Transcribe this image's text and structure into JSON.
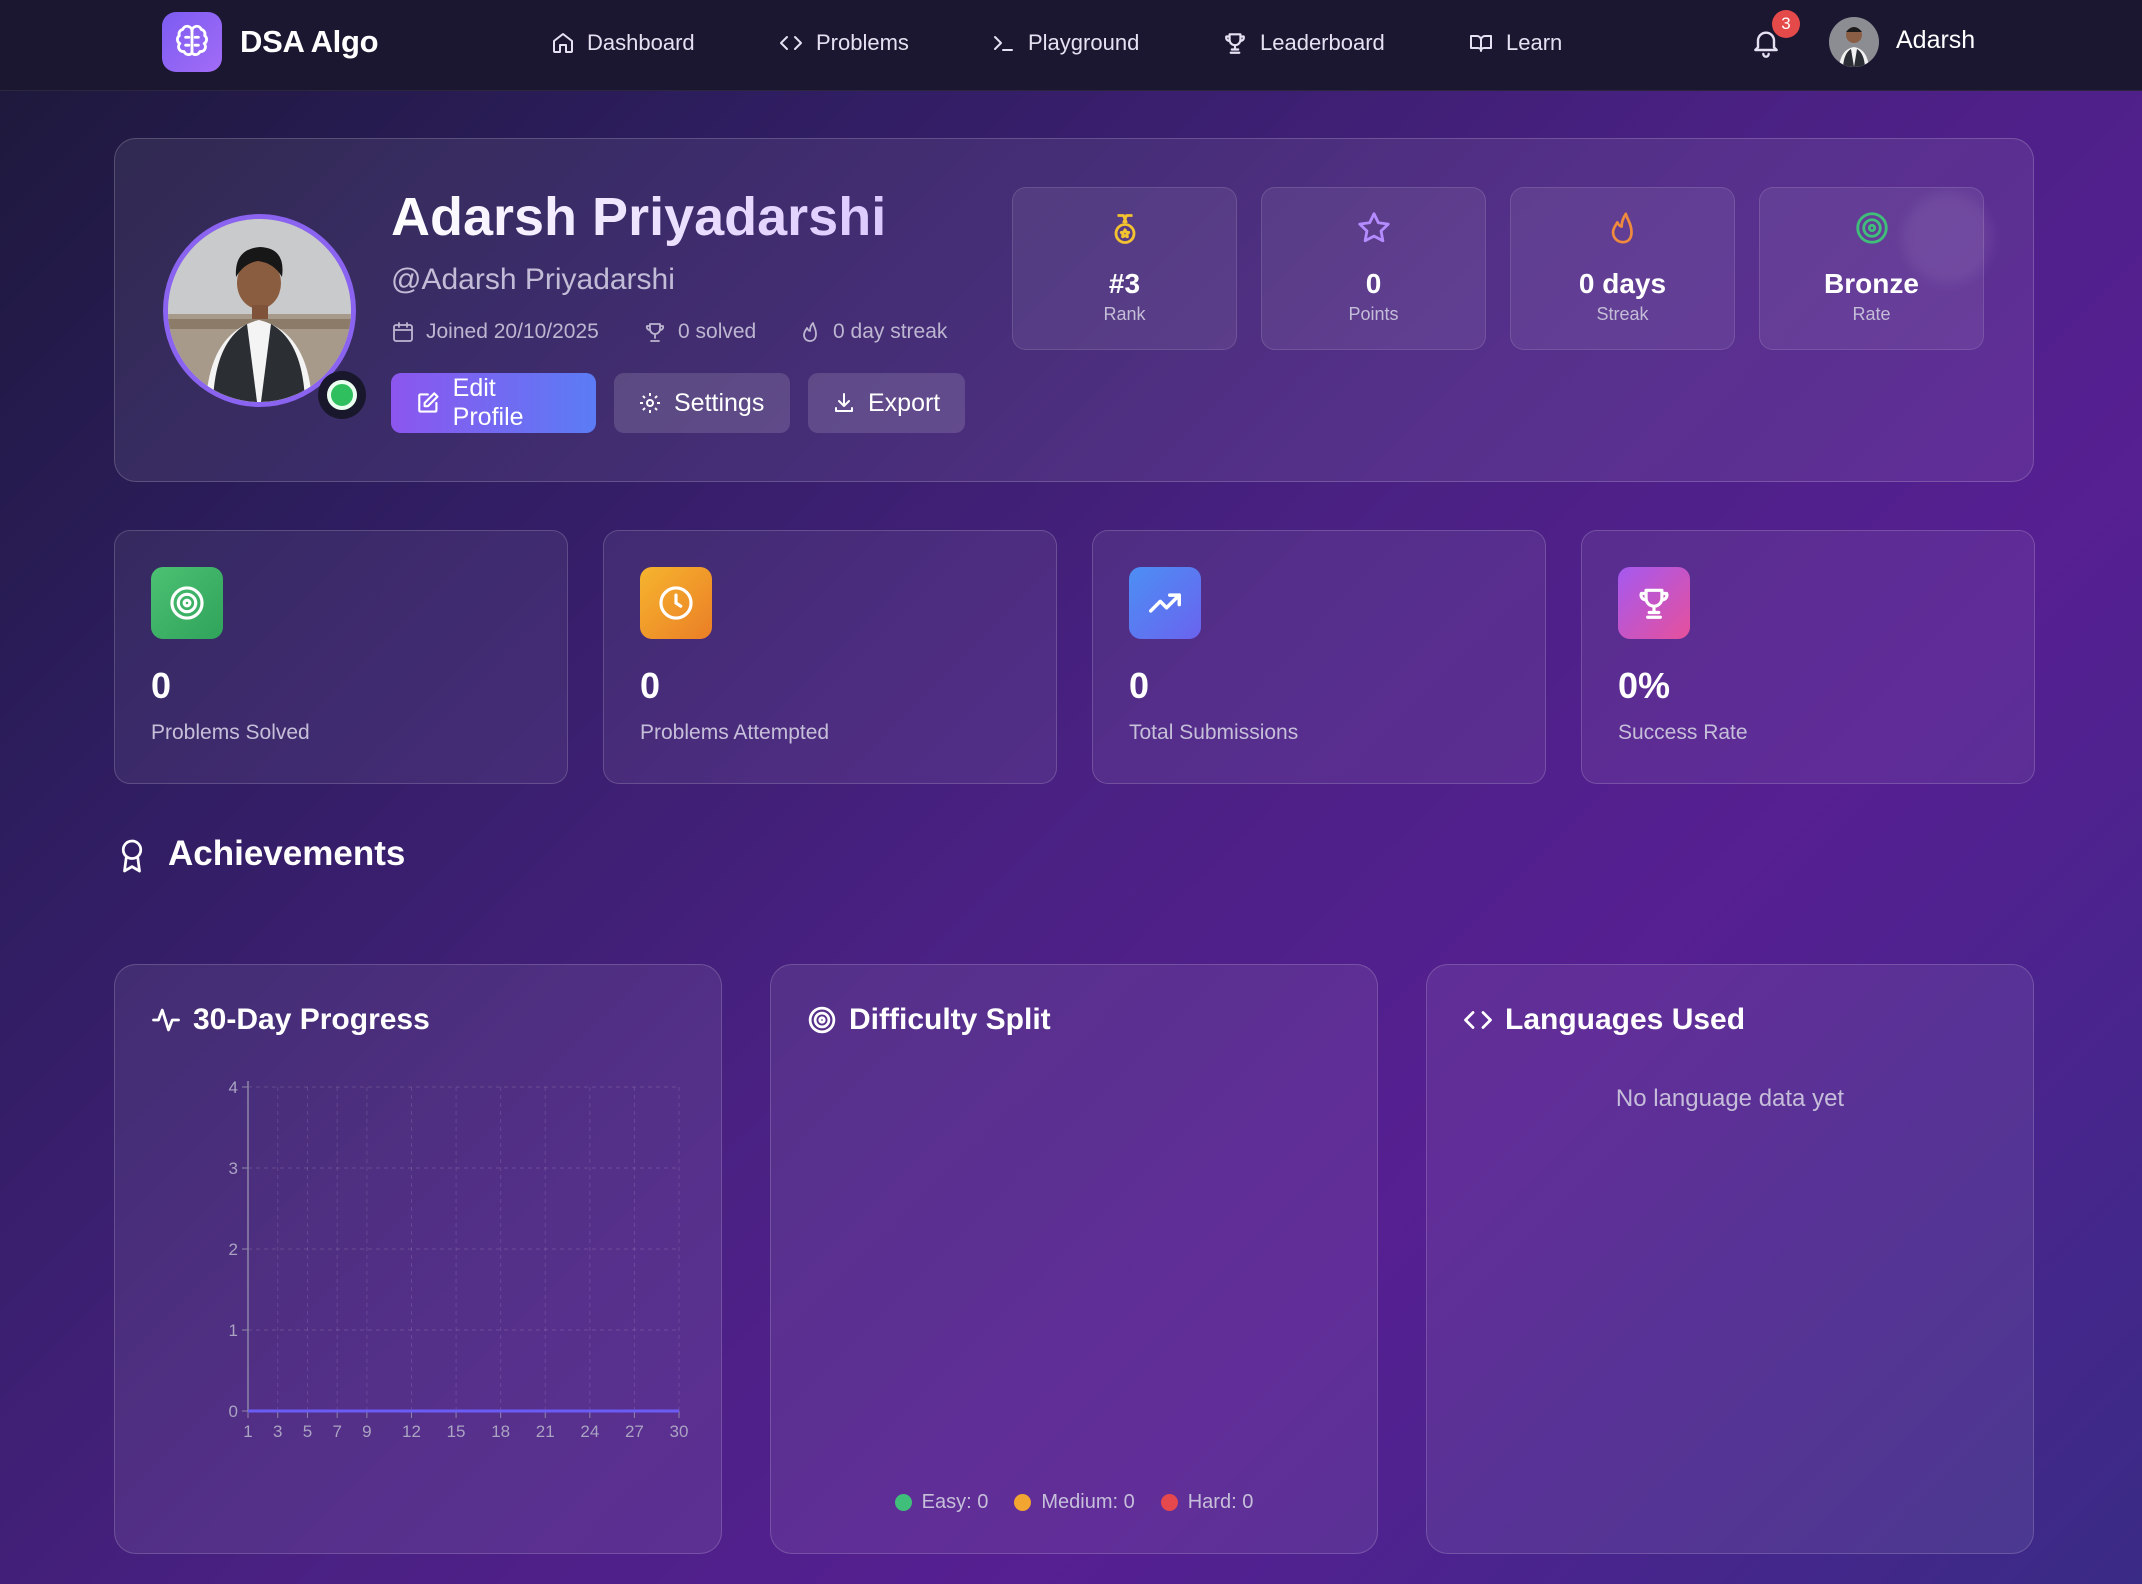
{
  "nav": {
    "brand": "DSA Algo",
    "links": [
      {
        "label": "Dashboard",
        "icon": "home-icon"
      },
      {
        "label": "Problems",
        "icon": "code-icon"
      },
      {
        "label": "Playground",
        "icon": "terminal-icon"
      },
      {
        "label": "Leaderboard",
        "icon": "trophy-icon"
      },
      {
        "label": "Learn",
        "icon": "book-icon"
      }
    ],
    "notification_count": "3",
    "username": "Adarsh"
  },
  "profile": {
    "name": "Adarsh Priyadarshi",
    "handle": "@Adarsh Priyadarshi",
    "joined": "Joined 20/10/2025",
    "solved": "0 solved",
    "streak": "0 day streak",
    "buttons": {
      "edit": "Edit Profile",
      "settings": "Settings",
      "export": "Export"
    },
    "stats": [
      {
        "value": "#3",
        "label": "Rank",
        "icon": "medal-icon",
        "color": "#f2c230"
      },
      {
        "value": "0",
        "label": "Points",
        "icon": "star-icon",
        "color": "#b48cff"
      },
      {
        "value": "0 days",
        "label": "Streak",
        "icon": "flame-icon",
        "color": "#f08a3c"
      },
      {
        "value": "Bronze",
        "label": "Rate",
        "icon": "target-icon",
        "color": "#3fbf7a"
      }
    ]
  },
  "metrics": [
    {
      "value": "0",
      "label": "Problems Solved",
      "icon": "target-icon"
    },
    {
      "value": "0",
      "label": "Problems Attempted",
      "icon": "clock-icon"
    },
    {
      "value": "0",
      "label": "Total Submissions",
      "icon": "trending-up-icon"
    },
    {
      "value": "0%",
      "label": "Success Rate",
      "icon": "trophy-icon"
    }
  ],
  "achievements": {
    "title": "Achievements"
  },
  "panels": {
    "progress": {
      "title": "30-Day Progress"
    },
    "difficulty": {
      "title": "Difficulty Split",
      "legend": [
        "Easy: 0",
        "Medium: 0",
        "Hard: 0"
      ],
      "colors": [
        "#3fbf7a",
        "#f2a531",
        "#e5484d"
      ]
    },
    "languages": {
      "title": "Languages Used",
      "empty": "No language data yet"
    }
  },
  "chart_data": {
    "type": "line",
    "title": "30-Day Progress",
    "x": [
      1,
      2,
      3,
      4,
      5,
      6,
      7,
      8,
      9,
      10,
      11,
      12,
      13,
      14,
      15,
      16,
      17,
      18,
      19,
      20,
      21,
      22,
      23,
      24,
      25,
      26,
      27,
      28,
      29,
      30
    ],
    "y": [
      0,
      0,
      0,
      0,
      0,
      0,
      0,
      0,
      0,
      0,
      0,
      0,
      0,
      0,
      0,
      0,
      0,
      0,
      0,
      0,
      0,
      0,
      0,
      0,
      0,
      0,
      0,
      0,
      0,
      0
    ],
    "x_ticks": [
      1,
      3,
      5,
      7,
      9,
      12,
      15,
      18,
      21,
      24,
      27,
      30
    ],
    "y_ticks": [
      0,
      1,
      2,
      3,
      4
    ],
    "ylim": [
      0,
      4
    ],
    "xlim": [
      1,
      30
    ],
    "grid": true,
    "line_color": "#6a5cf5"
  }
}
